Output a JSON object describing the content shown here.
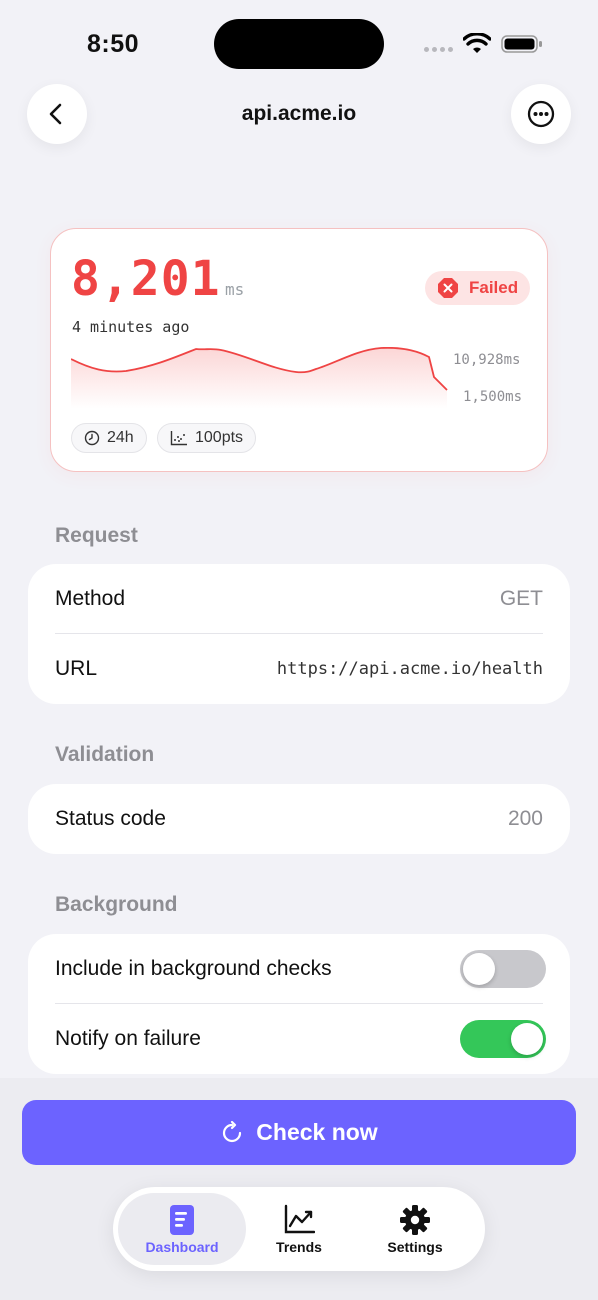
{
  "status_bar": {
    "time": "8:50"
  },
  "nav": {
    "title": "api.acme.io"
  },
  "hero": {
    "value": "8,201",
    "unit": "ms",
    "ago": "4 minutes ago",
    "status": "Failed",
    "status_color": "#ef4444",
    "spark_max": "10,928ms",
    "spark_min": "1,500ms",
    "range_chip": "24h",
    "points_chip": "100pts"
  },
  "request": {
    "header": "Request",
    "rows": [
      {
        "label": "Method",
        "value": "GET"
      },
      {
        "label": "URL",
        "value": "https://api.acme.io/health"
      }
    ]
  },
  "validation": {
    "header": "Validation",
    "rows": [
      {
        "label": "Status code",
        "value": "200"
      }
    ]
  },
  "background": {
    "header": "Background",
    "rows": [
      {
        "label": "Include in background checks",
        "enabled": false
      },
      {
        "label": "Notify on failure",
        "enabled": true
      }
    ]
  },
  "actions": {
    "check_now": "Check now",
    "accent": "#6c63ff"
  },
  "tabs": [
    {
      "label": "Dashboard",
      "icon": "document-icon",
      "active": true
    },
    {
      "label": "Trends",
      "icon": "chart-line-icon",
      "active": false
    },
    {
      "label": "Settings",
      "icon": "gear-icon",
      "active": false
    }
  ]
}
